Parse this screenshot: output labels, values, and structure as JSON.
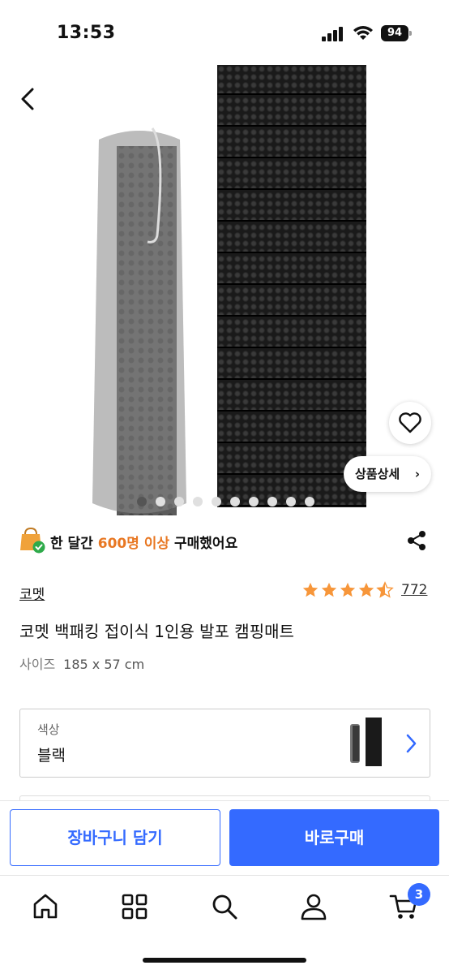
{
  "status_bar": {
    "time": "13:53",
    "battery": "94"
  },
  "hero": {
    "detail_label": "상품상세",
    "dots_total": 10,
    "dots_active": 0
  },
  "social_proof": {
    "prefix": "한 달간 ",
    "highlight": "600명 이상",
    "suffix": " 구매했어요",
    "highlight_color": "#e87722"
  },
  "product": {
    "brand": "코멧",
    "rating": 4.5,
    "review_count": "772",
    "title": "코멧 백패킹 접이식 1인용 발포 캠핑매트",
    "size_label": "사이즈",
    "size_value": "185 x 57 cm"
  },
  "option": {
    "label": "색상",
    "value": "블랙"
  },
  "actions": {
    "cart_label": "장바구니 담기",
    "buy_label": "바로구매",
    "accent_color": "#346aff"
  },
  "tab_bar": {
    "items": [
      "home-icon",
      "category-icon",
      "search-icon",
      "my-icon",
      "cart-icon"
    ],
    "cart_badge": "3"
  },
  "icons": {
    "back": "back-arrow-icon",
    "wishlist": "heart-icon",
    "share": "share-icon",
    "star": "star-icon",
    "chevron": "chevron-right-icon"
  }
}
